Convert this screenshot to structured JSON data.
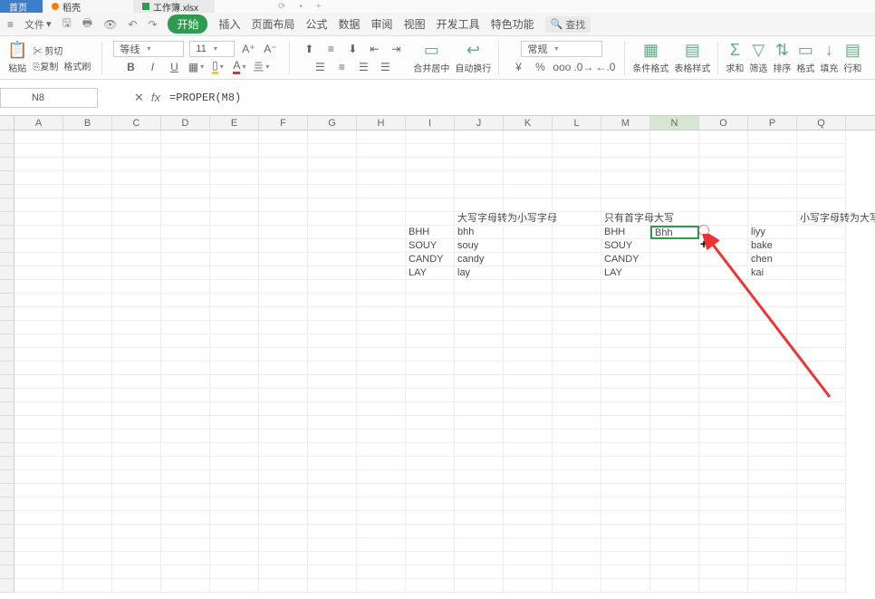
{
  "tabs": {
    "t1": "首页",
    "t2": "稻壳",
    "t3": "工作簿.xlsx"
  },
  "menubar": {
    "file": "文件",
    "start": "开始",
    "insert": "插入",
    "page": "页面布局",
    "formula": "公式",
    "data": "数据",
    "review": "审阅",
    "view": "视图",
    "dev": "开发工具",
    "special": "特色功能",
    "search": "查找"
  },
  "ribbon": {
    "paste": "粘贴",
    "cut": "剪切",
    "copy": "复制",
    "fmtpaint": "格式刷",
    "font": "等线",
    "fontsize": "11",
    "merge": "合并居中",
    "wrap": "自动换行",
    "numfmt": "常规",
    "condfmt": "条件格式",
    "tablestyle": "表格样式",
    "sum": "求和",
    "filter": "筛选",
    "sort": "排序",
    "format": "格式",
    "fill": "填充",
    "rowcol": "行和"
  },
  "fbar": {
    "cell": "N8",
    "formula": "=PROPER(M8)"
  },
  "cols": [
    "A",
    "B",
    "C",
    "D",
    "E",
    "F",
    "G",
    "H",
    "I",
    "J",
    "K",
    "L",
    "M",
    "N",
    "O",
    "P",
    "Q"
  ],
  "selectedCol": "N",
  "data": {
    "r7": {
      "J": "大写字母转为小写字母",
      "M": "只有首字母大写",
      "Q": "小写字母转为大写字"
    },
    "r8": {
      "I": "BHH",
      "J": "bhh",
      "M": "BHH",
      "N": "Bhh",
      "P": "liyy"
    },
    "r9": {
      "I": "SOUY",
      "J": "souy",
      "M": "SOUY",
      "P": "bake"
    },
    "r10": {
      "I": "CANDY",
      "J": "candy",
      "M": "CANDY",
      "P": "chen"
    },
    "r11": {
      "I": "LAY",
      "J": "lay",
      "M": "LAY",
      "P": "kai"
    }
  },
  "colwidths": {
    "A": 54,
    "B": 54,
    "C": 54,
    "D": 54,
    "E": 54,
    "F": 54,
    "G": 54,
    "H": 54,
    "I": 54,
    "J": 54,
    "K": 54,
    "L": 54,
    "M": 54,
    "N": 54,
    "O": 54,
    "P": 54,
    "Q": 54
  }
}
